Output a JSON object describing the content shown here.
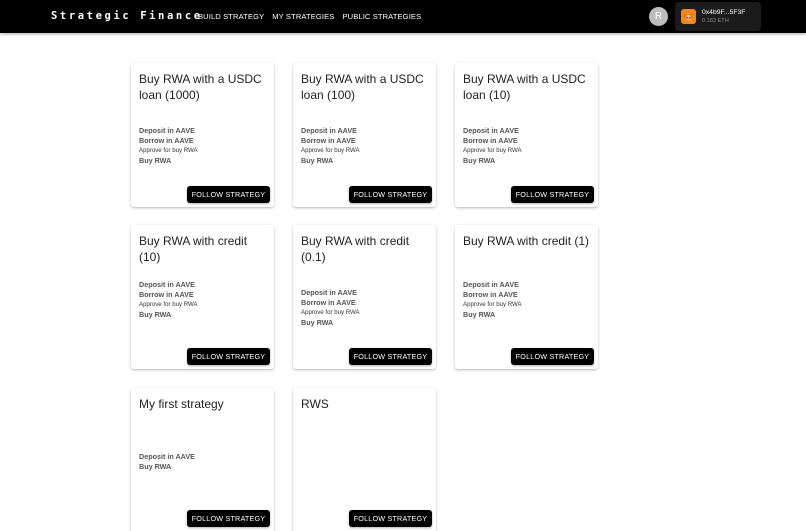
{
  "navbar": {
    "brand": "Strategic Finance",
    "links": [
      {
        "label": "BUILD STRATEGY"
      },
      {
        "label": "MY STRATEGIES"
      },
      {
        "label": "PUBLIC STRATEGIES"
      }
    ],
    "avatar_initial": "R",
    "wallet": {
      "address": "0x4b9F...5F3F",
      "balance": "0.183 ETH",
      "icon": "metamask-fox-icon"
    }
  },
  "cards": [
    {
      "title": "Buy RWA with a USDC loan (1000)",
      "steps": [
        "Deposit in AAVE",
        "Borrow in AAVE",
        "Approve for buy RWA",
        "Buy RWA"
      ],
      "button": "FOLLOW STRATEGY"
    },
    {
      "title": "Buy RWA with a USDC loan (100)",
      "steps": [
        "Deposit in AAVE",
        "Borrow in AAVE",
        "Approve for buy RWA",
        "Buy RWA"
      ],
      "button": "FOLLOW STRATEGY"
    },
    {
      "title": "Buy RWA with a USDC loan (10)",
      "steps": [
        "Deposit in AAVE",
        "Borrow in AAVE",
        "Approve for buy RWA",
        "Buy RWA"
      ],
      "button": "FOLLOW STRATEGY"
    },
    {
      "title": "Buy RWA with credit (10)",
      "steps": [
        "Deposit in AAVE",
        "Borrow in AAVE",
        "Approve for buy RWA",
        "Buy RWA"
      ],
      "button": "FOLLOW STRATEGY"
    },
    {
      "title": "Buy RWA with credit (0.1)",
      "steps": [
        "Deposit in AAVE",
        "Borrow in AAVE",
        "Approve for buy RWA",
        "Buy RWA"
      ],
      "button": "FOLLOW STRATEGY"
    },
    {
      "title": "Buy RWA with credit (1)",
      "steps": [
        "Deposit in AAVE",
        "Borrow in AAVE",
        "Approve for buy RWA",
        "Buy RWA"
      ],
      "button": "FOLLOW STRATEGY"
    },
    {
      "title": "My first strategy",
      "steps": [
        "Deposit in AAVE",
        "Buy RWA"
      ],
      "button": "FOLLOW STRATEGY"
    },
    {
      "title": "RWS",
      "steps": [],
      "button": "FOLLOW STRATEGY"
    }
  ]
}
